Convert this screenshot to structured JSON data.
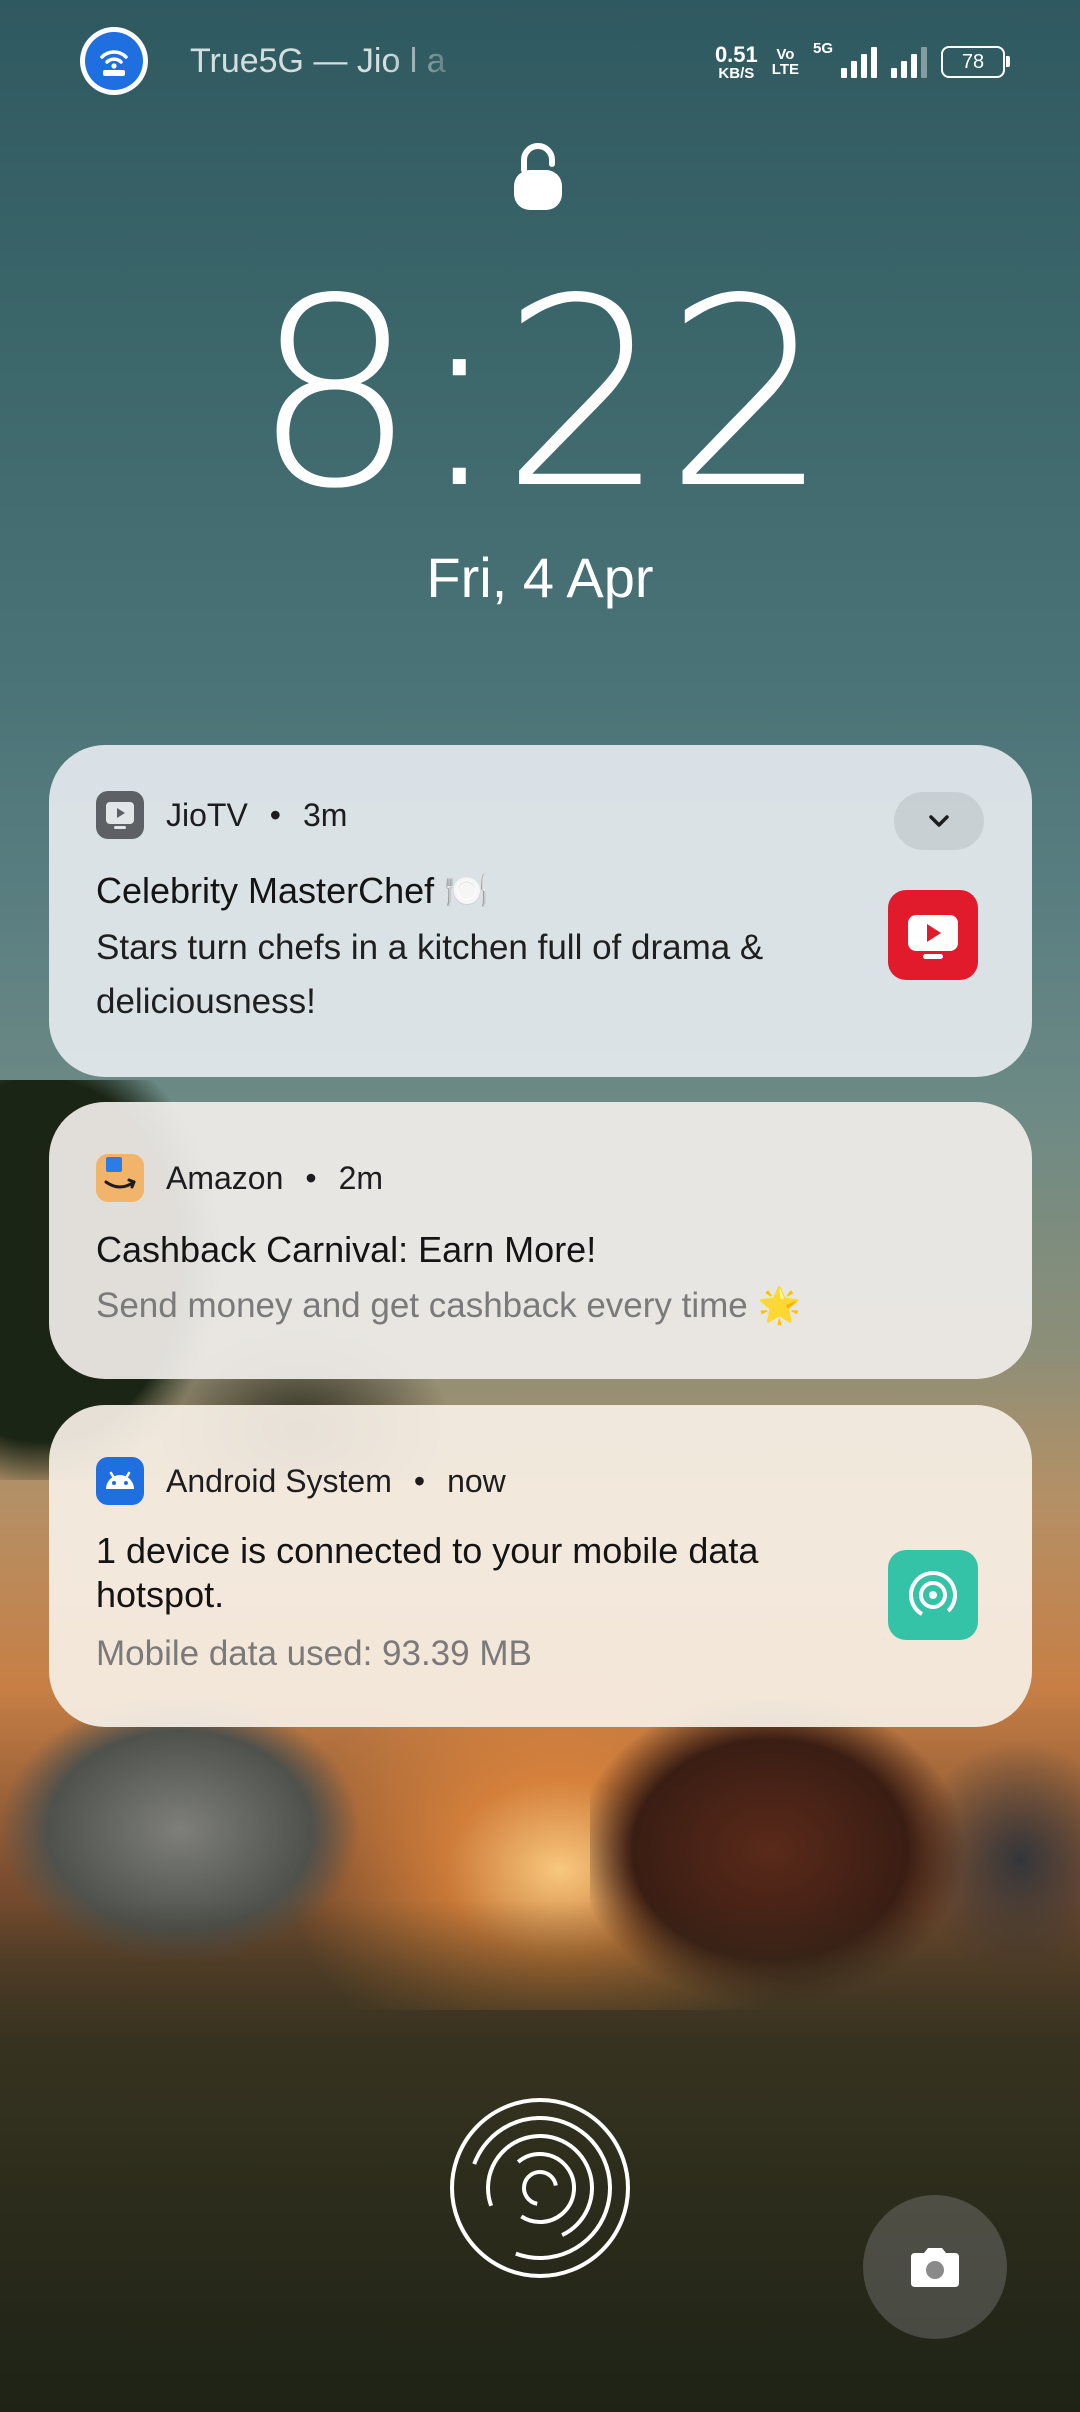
{
  "status_bar": {
    "hotspot_icon": "hotspot-icon",
    "carrier": "True5G — Jio l a",
    "speed_value": "0.51",
    "speed_unit": "KB/S",
    "volte_top": "Vo",
    "volte_bottom": "LTE",
    "network_type": "5G",
    "battery": "78"
  },
  "lock_icon": "lock-icon",
  "clock": "8:22",
  "date": "Fri, 4 Apr",
  "notifications": [
    {
      "app": "JioTV",
      "time": "3m",
      "icon": "jiotv-icon",
      "title": "Celebrity MasterChef 🍽️",
      "body": "Stars turn chefs in a kitchen full of drama & deliciousness!",
      "accent": "#e21b2c"
    },
    {
      "app": "Amazon",
      "time": "2m",
      "icon": "amazon-icon",
      "title": "Cashback Carnival: Earn More!",
      "body": "Send money and get cashback every time 🌟",
      "accent": "#f2b36b"
    },
    {
      "app": "Android System",
      "time": "now",
      "icon": "android-icon",
      "title": "1 device is connected to your mobile data hotspot.",
      "body": "Mobile data used: 93.39 MB",
      "accent": "#34c3a6"
    }
  ],
  "bottom": {
    "fingerprint_icon": "fingerprint-icon",
    "camera_icon": "camera-icon"
  }
}
